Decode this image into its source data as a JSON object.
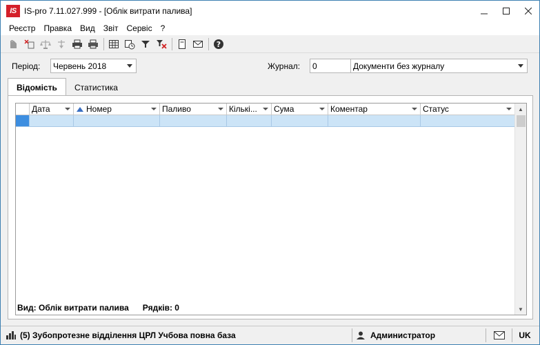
{
  "window": {
    "title": "IS-pro 7.11.027.999 - [Облік витрати палива]",
    "logo_text": "IS",
    "accent_color": "#d4202a"
  },
  "menu": [
    "Реєстр",
    "Правка",
    "Вид",
    "Звіт",
    "Сервіс",
    "?"
  ],
  "toolbar": {
    "icons": [
      "new-doc-icon",
      "delete-doc-icon",
      "balance-icon",
      "balance-down-icon",
      "print-icon",
      "print-preview-icon",
      "table-icon",
      "calendar-clock-icon",
      "filter-icon",
      "clear-filter-icon",
      "document-icon",
      "mail-icon",
      "help-icon"
    ]
  },
  "filters": {
    "period_label": "Період:",
    "period_value": "Червень 2018",
    "journal_label": "Журнал:",
    "journal_code": "0",
    "journal_value": "Документи без журналу"
  },
  "tabs": [
    "Відомість",
    "Статистика"
  ],
  "grid": {
    "columns": [
      "Дата",
      "Номер",
      "Паливо",
      "Кількі...",
      "Сума",
      "Коментар",
      "Статус"
    ],
    "footer_view": "Вид: Облік витрати палива",
    "footer_rows": "Рядків: 0"
  },
  "status": {
    "org": "(5) Зубопротезне відділення ЦРЛ Учбова повна база",
    "user": "Администратор",
    "lang": "UK"
  }
}
